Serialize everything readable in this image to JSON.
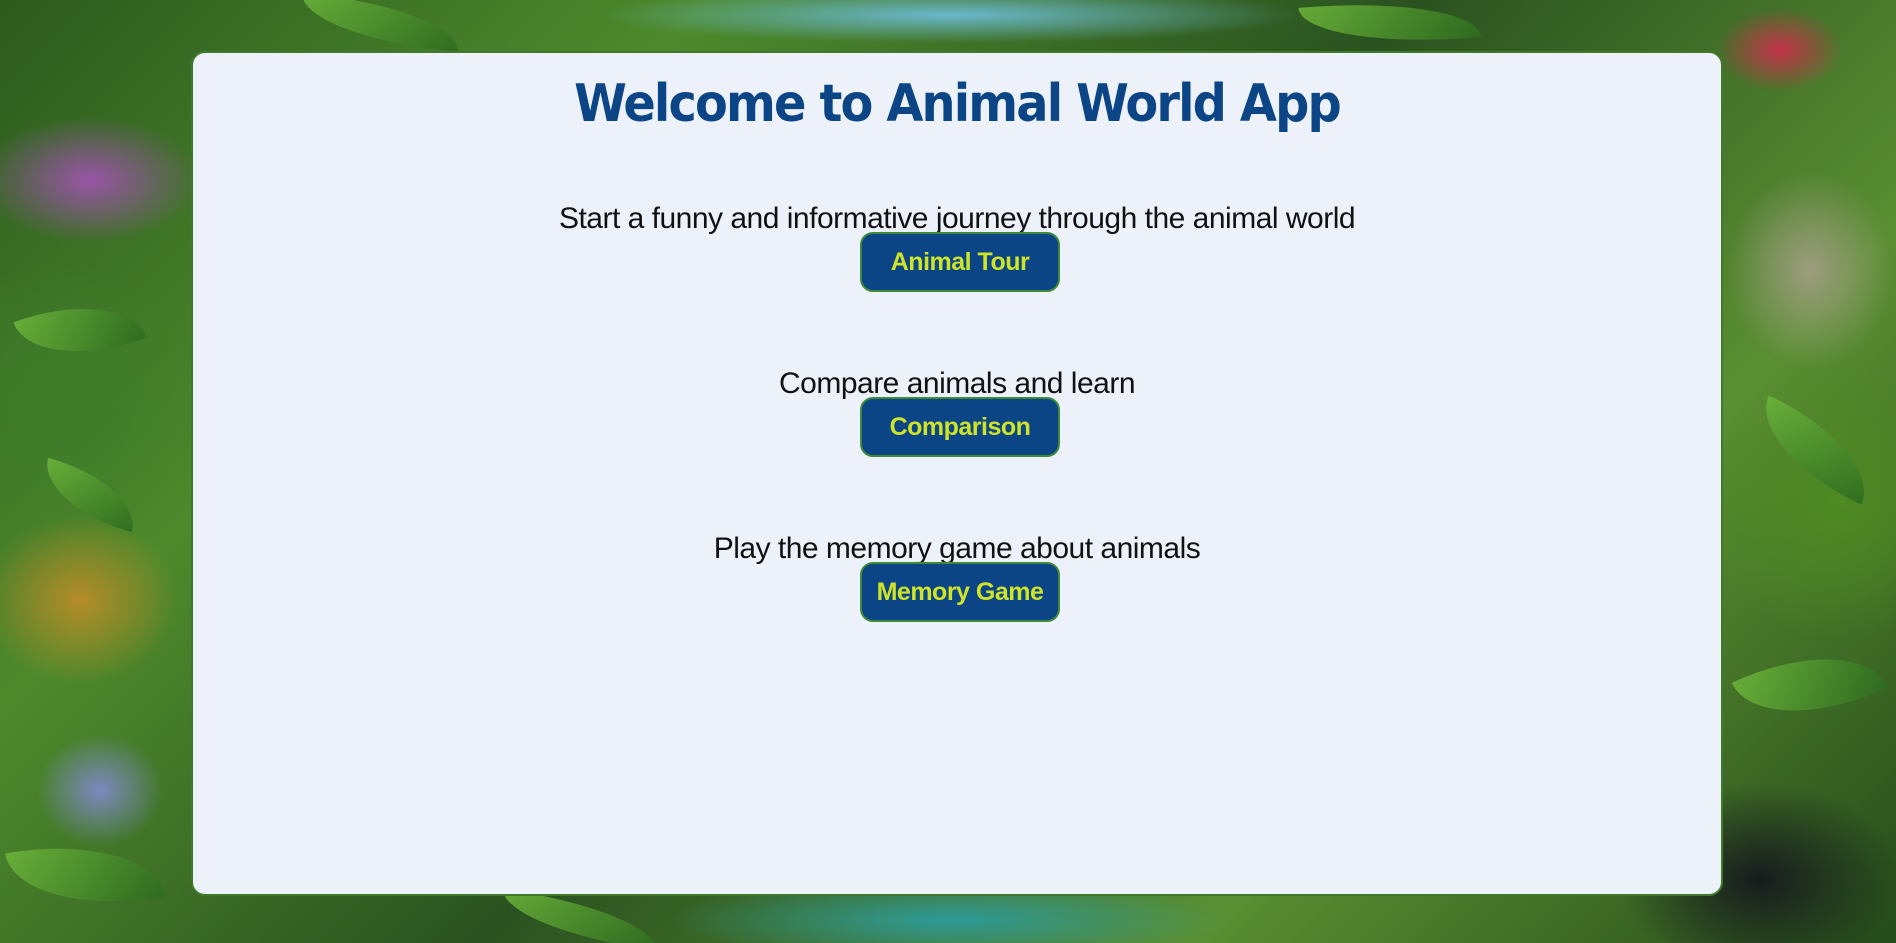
{
  "page": {
    "title": "Welcome to Animal World App"
  },
  "sections": [
    {
      "description": "Start a funny and informative journey through the animal world",
      "button_label": "Animal Tour"
    },
    {
      "description": "Compare animals and learn",
      "button_label": "Comparison"
    },
    {
      "description": "Play the memory game about animals",
      "button_label": "Memory Game"
    }
  ],
  "theme": {
    "card_background": "#edf2fa",
    "title_color": "#0b4585",
    "button_background": "#0b4585",
    "button_text_color": "#cfe327",
    "border_color": "#3e7a2a"
  }
}
